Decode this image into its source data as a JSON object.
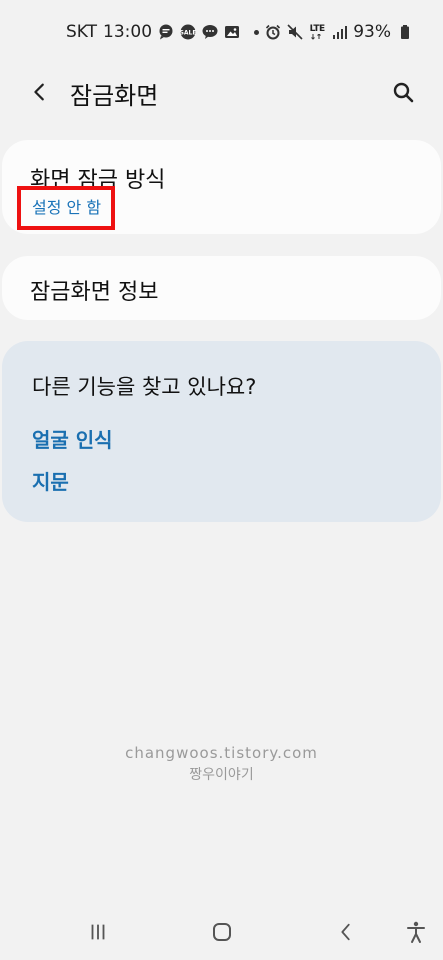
{
  "status_bar": {
    "carrier": "SKT",
    "time": "13:00",
    "notification_icons": [
      "chat-bubble-icon",
      "sale-icon",
      "message-icon",
      "image-icon"
    ],
    "system_icons": [
      "alarm-icon",
      "mute-icon",
      "lte-icon",
      "signal-icon",
      "battery-icon"
    ],
    "network": "LTE",
    "battery": "93%"
  },
  "app_bar": {
    "title": "잠금화면",
    "back_icon": "chevron-left-icon",
    "search_icon": "search-icon"
  },
  "settings": [
    {
      "title": "화면 잠금 방식",
      "subtitle": "설정 안 함"
    },
    {
      "title": "잠금화면 정보"
    }
  ],
  "suggestions": {
    "title": "다른 기능을 찾고 있나요?",
    "links": [
      "얼굴 인식",
      "지문"
    ]
  },
  "watermark": {
    "url": "changwoos.tistory.com",
    "name": "짱우이야기"
  },
  "nav_bar": {
    "icons": [
      "recent-apps-icon",
      "home-icon",
      "back-icon",
      "accessibility-icon"
    ]
  },
  "colors": {
    "background": "#f2f2f2",
    "card": "#fcfcfc",
    "suggestion_card": "#e1e8ef",
    "link": "#1a6fb0",
    "highlight": "#ee1111"
  }
}
